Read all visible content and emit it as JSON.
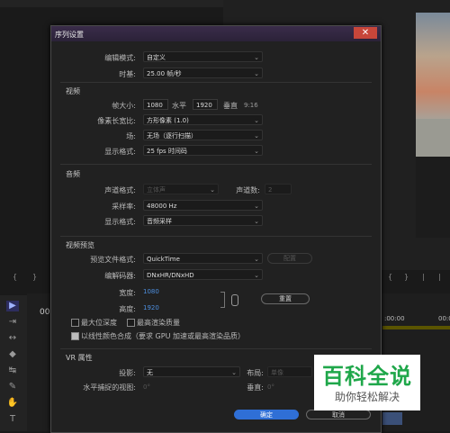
{
  "dialog": {
    "title": "序列设置",
    "close_icon": "close-icon",
    "edit_mode_label": "编辑模式:",
    "edit_mode_value": "自定义",
    "timebase_label": "时基:",
    "timebase_value": "25.00 帧/秒",
    "video": {
      "section": "视频",
      "frame_size_label": "帧大小:",
      "frame_width": "1080",
      "horizontal_label": "水平",
      "frame_height": "1920",
      "vertical_label": "垂直",
      "aspect": "9:16",
      "pixel_aspect_label": "像素长宽比:",
      "pixel_aspect_value": "方形像素 (1.0)",
      "fields_label": "场:",
      "fields_value": "无场（逐行扫描）",
      "display_format_label": "显示格式:",
      "display_format_value": "25 fps 时间码"
    },
    "audio": {
      "section": "音频",
      "channel_format_label": "声道格式:",
      "channel_format_value": "立体声",
      "channel_count_label": "声道数:",
      "channel_count_value": "2",
      "sample_rate_label": "采样率:",
      "sample_rate_value": "48000 Hz",
      "display_format_label": "显示格式:",
      "display_format_value": "音频采样"
    },
    "preview": {
      "section": "视频预览",
      "file_format_label": "预览文件格式:",
      "file_format_value": "QuickTime",
      "configure_button": "配置",
      "codec_label": "编解码器:",
      "codec_value": "DNxHR/DNxHD",
      "width_label": "宽度:",
      "width_value": "1080",
      "height_label": "高度:",
      "height_value": "1920",
      "reset_button": "重置",
      "max_bit_depth": "最大位深度",
      "max_render_quality": "最高渲染质量",
      "linear_color": "以线性颜色合成（要求 GPU 加速或最高渲染品质）"
    },
    "vr": {
      "section": "VR 属性",
      "projection_label": "投影:",
      "projection_value": "无",
      "layout_label": "布局:",
      "layout_value": "单像",
      "horizontal_view_label": "水平捕捉的视图:",
      "horizontal_view_value": "0°",
      "vertical_label": "垂直:",
      "vertical_value": "0°"
    },
    "ok_button": "确定",
    "cancel_button": "取消"
  },
  "background": {
    "timecode_left": "00",
    "timecode_right": ":00:00",
    "timecode_right2": "00:0"
  },
  "watermark": {
    "title": "百科全说",
    "subtitle": "助你轻松解决"
  },
  "colors": {
    "accent": "#2f6fd6",
    "link_blue": "#4d8fe0",
    "close_red": "#c7463a",
    "watermark_green": "#1fa74a"
  }
}
